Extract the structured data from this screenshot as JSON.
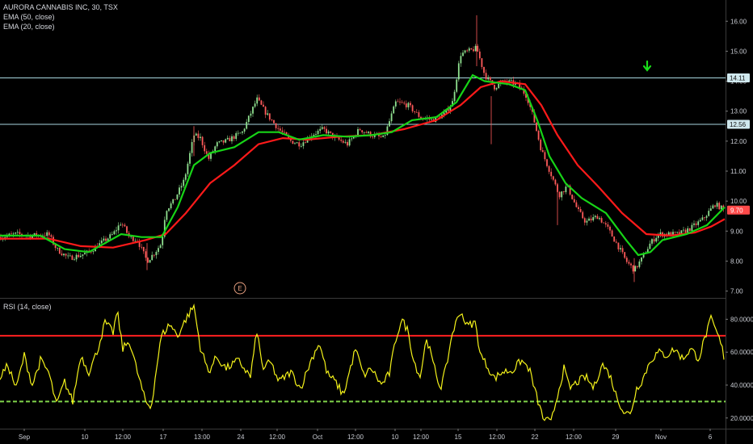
{
  "header": {
    "title": "AURORA CANNABIS INC, 30, TSX",
    "ema50_label": "EMA (50, close)",
    "ema20_label": "EMA (20, close)"
  },
  "rsi_panel": {
    "label": "RSI (14, close)"
  },
  "colors": {
    "background": "#000000",
    "candle_up": "#8fe08f",
    "candle_down": "#ff5a5a",
    "ema50": "#ff1a1a",
    "ema20": "#17d417",
    "hline": "#a8d6e0",
    "rsi_line": "#f4f21a",
    "rsi_upper": "#ff2020",
    "rsi_lower": "#7fd34a",
    "arrow": "#19e019",
    "earnings_marker": "#e8a080"
  },
  "markers": {
    "earnings": "E"
  },
  "chart_data": [
    {
      "type": "candlestick",
      "title": "AURORA CANNABIS INC, 30, TSX",
      "y_ticks": [
        "16.00",
        "15.00",
        "14.00",
        "13.00",
        "12.00",
        "11.00",
        "10.00",
        "9.00",
        "8.00",
        "7.00"
      ],
      "ylim": [
        6.8,
        16.6
      ],
      "horizontal_lines": [
        {
          "value": 14.11,
          "label": "14.11"
        },
        {
          "value": 12.56,
          "label": "12.56"
        }
      ],
      "last_price": {
        "value": 9.7,
        "label": "9.70"
      },
      "x_ticks": [
        "Sep",
        "10",
        "12:00",
        "17",
        "13:00",
        "24",
        "12:00",
        "Oct",
        "12:00",
        "10",
        "12:00",
        "15",
        "12:00",
        "22",
        "12:00",
        "29",
        "Nov",
        "6"
      ],
      "price_path": [
        [
          0,
          8.8
        ],
        [
          20,
          8.9
        ],
        [
          40,
          8.85
        ],
        [
          60,
          8.9
        ],
        [
          70,
          8.4
        ],
        [
          85,
          8.1
        ],
        [
          100,
          8.2
        ],
        [
          110,
          8.3
        ],
        [
          125,
          8.6
        ],
        [
          140,
          8.9
        ],
        [
          150,
          9.3
        ],
        [
          160,
          8.8
        ],
        [
          170,
          8.7
        ],
        [
          182,
          8.0
        ],
        [
          192,
          8.3
        ],
        [
          200,
          8.6
        ],
        [
          205,
          9.7
        ],
        [
          215,
          10.0
        ],
        [
          228,
          10.7
        ],
        [
          240,
          12.2
        ],
        [
          248,
          12.1
        ],
        [
          258,
          11.4
        ],
        [
          268,
          11.9
        ],
        [
          280,
          12.0
        ],
        [
          300,
          12.3
        ],
        [
          318,
          13.4
        ],
        [
          330,
          12.9
        ],
        [
          345,
          12.4
        ],
        [
          360,
          12.0
        ],
        [
          372,
          11.9
        ],
        [
          385,
          12.2
        ],
        [
          400,
          12.4
        ],
        [
          415,
          12.1
        ],
        [
          430,
          11.9
        ],
        [
          445,
          12.4
        ],
        [
          460,
          12.2
        ],
        [
          475,
          12.1
        ],
        [
          490,
          13.3
        ],
        [
          505,
          13.2
        ],
        [
          520,
          12.8
        ],
        [
          535,
          12.7
        ],
        [
          550,
          12.9
        ],
        [
          560,
          13.3
        ],
        [
          570,
          14.9
        ],
        [
          580,
          15.0
        ],
        [
          590,
          15.1
        ],
        [
          600,
          14.2
        ],
        [
          612,
          13.8
        ],
        [
          625,
          14.0
        ],
        [
          640,
          13.9
        ],
        [
          652,
          13.5
        ],
        [
          660,
          12.8
        ],
        [
          670,
          11.7
        ],
        [
          682,
          10.9
        ],
        [
          692,
          10.2
        ],
        [
          702,
          10.5
        ],
        [
          715,
          9.7
        ],
        [
          725,
          9.3
        ],
        [
          740,
          9.5
        ],
        [
          752,
          9.1
        ],
        [
          765,
          8.5
        ],
        [
          775,
          8.0
        ],
        [
          785,
          7.7
        ],
        [
          795,
          8.1
        ],
        [
          805,
          8.6
        ],
        [
          815,
          8.9
        ],
        [
          825,
          8.9
        ],
        [
          840,
          8.9
        ],
        [
          855,
          9.1
        ],
        [
          870,
          9.4
        ],
        [
          885,
          9.9
        ],
        [
          897,
          9.7
        ]
      ],
      "ema20_path": [
        [
          0,
          8.85
        ],
        [
          50,
          8.85
        ],
        [
          80,
          8.4
        ],
        [
          110,
          8.3
        ],
        [
          150,
          8.9
        ],
        [
          175,
          8.8
        ],
        [
          200,
          8.8
        ],
        [
          220,
          9.8
        ],
        [
          240,
          11.2
        ],
        [
          260,
          11.6
        ],
        [
          290,
          11.8
        ],
        [
          320,
          12.3
        ],
        [
          345,
          12.3
        ],
        [
          370,
          12.05
        ],
        [
          400,
          12.2
        ],
        [
          430,
          12.15
        ],
        [
          460,
          12.2
        ],
        [
          485,
          12.3
        ],
        [
          510,
          12.7
        ],
        [
          540,
          12.8
        ],
        [
          565,
          13.3
        ],
        [
          585,
          14.2
        ],
        [
          600,
          14.0
        ],
        [
          630,
          13.9
        ],
        [
          650,
          13.7
        ],
        [
          665,
          12.7
        ],
        [
          680,
          11.5
        ],
        [
          700,
          10.6
        ],
        [
          720,
          10.1
        ],
        [
          750,
          9.6
        ],
        [
          775,
          8.7
        ],
        [
          790,
          8.2
        ],
        [
          805,
          8.3
        ],
        [
          820,
          8.7
        ],
        [
          850,
          8.9
        ],
        [
          875,
          9.2
        ],
        [
          897,
          9.8
        ]
      ],
      "ema50_path": [
        [
          0,
          8.75
        ],
        [
          60,
          8.75
        ],
        [
          100,
          8.5
        ],
        [
          140,
          8.45
        ],
        [
          180,
          8.7
        ],
        [
          205,
          8.9
        ],
        [
          230,
          9.6
        ],
        [
          260,
          10.6
        ],
        [
          290,
          11.2
        ],
        [
          320,
          11.9
        ],
        [
          350,
          12.1
        ],
        [
          380,
          12.05
        ],
        [
          420,
          12.15
        ],
        [
          460,
          12.2
        ],
        [
          500,
          12.4
        ],
        [
          540,
          12.7
        ],
        [
          570,
          13.2
        ],
        [
          595,
          13.8
        ],
        [
          620,
          14.0
        ],
        [
          650,
          13.9
        ],
        [
          670,
          13.2
        ],
        [
          690,
          12.2
        ],
        [
          715,
          11.2
        ],
        [
          740,
          10.5
        ],
        [
          770,
          9.6
        ],
        [
          800,
          8.9
        ],
        [
          830,
          8.85
        ],
        [
          860,
          8.95
        ],
        [
          880,
          9.15
        ],
        [
          897,
          9.4
        ]
      ]
    },
    {
      "type": "line",
      "title": "RSI (14, close)",
      "y_ticks": [
        "80.0000",
        "60.0000",
        "40.0000",
        "20.0000"
      ],
      "ylim": [
        14,
        92
      ],
      "upper_band": 70,
      "lower_band": 30,
      "rsi_path": [
        [
          0,
          45
        ],
        [
          10,
          52
        ],
        [
          20,
          38
        ],
        [
          30,
          58
        ],
        [
          40,
          40
        ],
        [
          50,
          55
        ],
        [
          60,
          48
        ],
        [
          70,
          28
        ],
        [
          80,
          42
        ],
        [
          90,
          30
        ],
        [
          100,
          58
        ],
        [
          110,
          48
        ],
        [
          120,
          60
        ],
        [
          130,
          78
        ],
        [
          140,
          72
        ],
        [
          145,
          85
        ],
        [
          152,
          62
        ],
        [
          160,
          67
        ],
        [
          170,
          48
        ],
        [
          180,
          30
        ],
        [
          187,
          26
        ],
        [
          195,
          55
        ],
        [
          200,
          70
        ],
        [
          210,
          77
        ],
        [
          220,
          70
        ],
        [
          230,
          80
        ],
        [
          240,
          88
        ],
        [
          248,
          63
        ],
        [
          258,
          48
        ],
        [
          268,
          57
        ],
        [
          280,
          50
        ],
        [
          295,
          55
        ],
        [
          310,
          45
        ],
        [
          318,
          73
        ],
        [
          325,
          50
        ],
        [
          335,
          54
        ],
        [
          345,
          42
        ],
        [
          360,
          48
        ],
        [
          372,
          38
        ],
        [
          385,
          55
        ],
        [
          395,
          66
        ],
        [
          405,
          47
        ],
        [
          415,
          42
        ],
        [
          425,
          34
        ],
        [
          440,
          62
        ],
        [
          450,
          46
        ],
        [
          460,
          50
        ],
        [
          472,
          40
        ],
        [
          482,
          47
        ],
        [
          490,
          68
        ],
        [
          497,
          80
        ],
        [
          505,
          73
        ],
        [
          512,
          55
        ],
        [
          520,
          45
        ],
        [
          528,
          69
        ],
        [
          535,
          55
        ],
        [
          545,
          38
        ],
        [
          552,
          50
        ],
        [
          560,
          72
        ],
        [
          570,
          85
        ],
        [
          578,
          76
        ],
        [
          588,
          78
        ],
        [
          595,
          58
        ],
        [
          605,
          50
        ],
        [
          612,
          44
        ],
        [
          622,
          48
        ],
        [
          635,
          49
        ],
        [
          645,
          55
        ],
        [
          655,
          50
        ],
        [
          663,
          35
        ],
        [
          672,
          20
        ],
        [
          682,
          17
        ],
        [
          690,
          34
        ],
        [
          698,
          50
        ],
        [
          705,
          38
        ],
        [
          715,
          42
        ],
        [
          725,
          45
        ],
        [
          735,
          38
        ],
        [
          745,
          53
        ],
        [
          755,
          46
        ],
        [
          763,
          33
        ],
        [
          772,
          24
        ],
        [
          780,
          22
        ],
        [
          788,
          38
        ],
        [
          795,
          43
        ],
        [
          805,
          55
        ],
        [
          815,
          60
        ],
        [
          825,
          58
        ],
        [
          835,
          62
        ],
        [
          845,
          56
        ],
        [
          855,
          62
        ],
        [
          865,
          56
        ],
        [
          872,
          68
        ],
        [
          880,
          80
        ],
        [
          887,
          72
        ],
        [
          893,
          64
        ],
        [
          897,
          55
        ]
      ]
    }
  ]
}
